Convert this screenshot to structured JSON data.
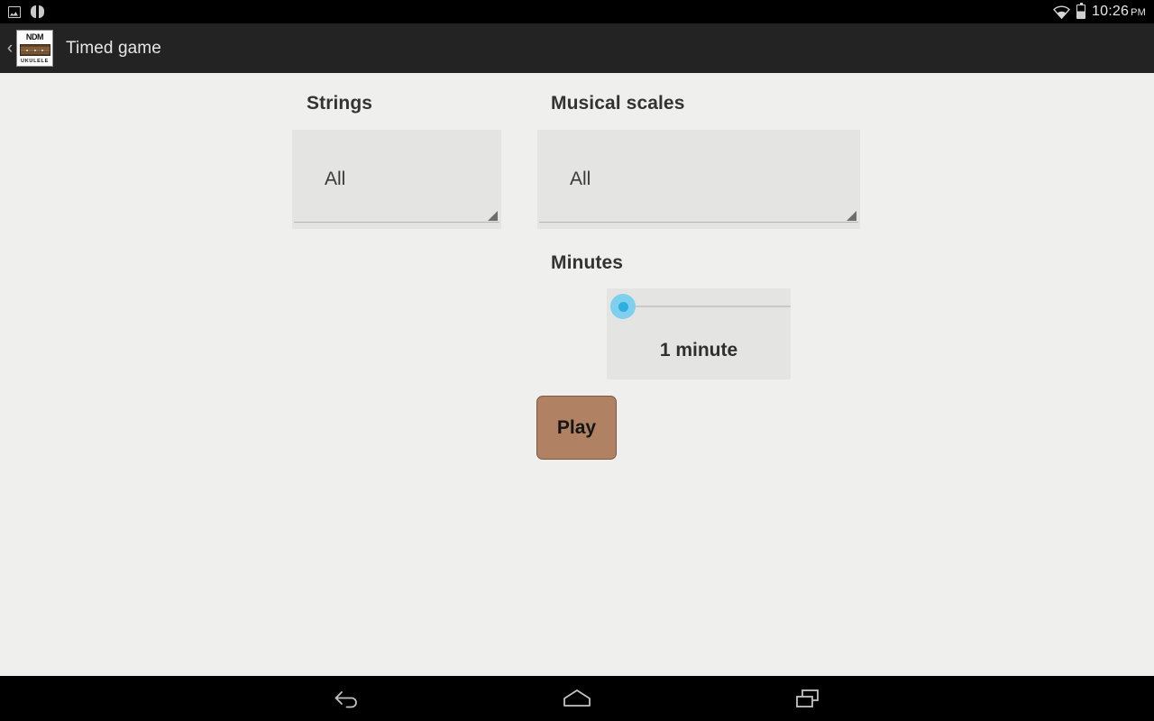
{
  "status_bar": {
    "left_icons": [
      "screenshot-icon",
      "pause-icon"
    ],
    "right_icons": [
      "wifi-icon",
      "battery-icon"
    ],
    "time": "10:26",
    "am_pm": "PM"
  },
  "action_bar": {
    "up_chevron": "‹",
    "app_icon": {
      "top_text": "NDM",
      "bottom_text": "UKULELE"
    },
    "title": "Timed game"
  },
  "main": {
    "strings_section": {
      "title": "Strings",
      "spinner_value": "All"
    },
    "scales_section": {
      "title": "Musical scales",
      "spinner_value": "All"
    },
    "minutes_section": {
      "title": "Minutes",
      "slider_value_label": "1 minute",
      "slider_position_percent": 0
    },
    "play_button_label": "Play"
  },
  "nav_bar": {
    "back_label": "back-icon",
    "home_label": "home-icon",
    "recents_label": "recents-icon"
  },
  "colors": {
    "accent_blue": "#2eaee0",
    "accent_blue_halo": "#7fd0ec",
    "play_brown": "#b08263",
    "action_bar": "#232323",
    "page_background": "#efefee",
    "panel_gray": "#e4e4e3"
  }
}
